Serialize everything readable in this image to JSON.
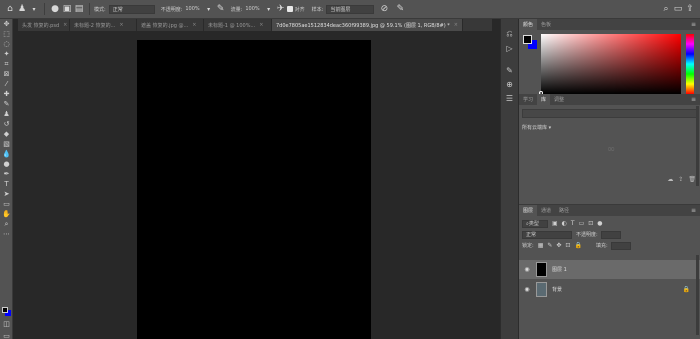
{
  "options_bar": {
    "mode_label": "模式:",
    "mode_value": "正常",
    "opacity_label": "不透明度:",
    "opacity_value": "100%",
    "flow_label": "流量:",
    "flow_value": "100%",
    "align_label": "对齐",
    "sample_label": "样本:",
    "sample_value": "当前图层"
  },
  "tabs": [
    {
      "label": "头发 恢复的.psd",
      "active": false
    },
    {
      "label": "未标题-2 恢复的...",
      "active": false
    },
    {
      "label": "遮盖 恢复的.jpg @...",
      "active": false
    },
    {
      "label": "未标题-1 @ 100%...",
      "active": false
    },
    {
      "label": "7d0e7805ae1512834deac360f99389.jpg @ 59.1% (图层 1, RGB/8#) *",
      "active": true
    }
  ],
  "panels": {
    "color_tabs": [
      "颜色",
      "色板"
    ],
    "library_tabs": [
      "学习",
      "库",
      "调整"
    ],
    "library_select": "所有云端库",
    "layer_tabs": [
      "图层",
      "通道",
      "路径"
    ],
    "kind_label": "类型",
    "blend_mode": "正常",
    "opacity_label": "不透明度:",
    "lock_label": "锁定:",
    "fill_label": "填充:"
  },
  "layers": [
    {
      "name": "图层 1",
      "selected": true,
      "thumb": "#000000",
      "locked": false
    },
    {
      "name": "背景",
      "selected": false,
      "thumb": "#5a6a72",
      "locked": true
    }
  ],
  "colors": {
    "foreground": "#000000",
    "background": "#0000ff",
    "canvas": "#000000"
  }
}
